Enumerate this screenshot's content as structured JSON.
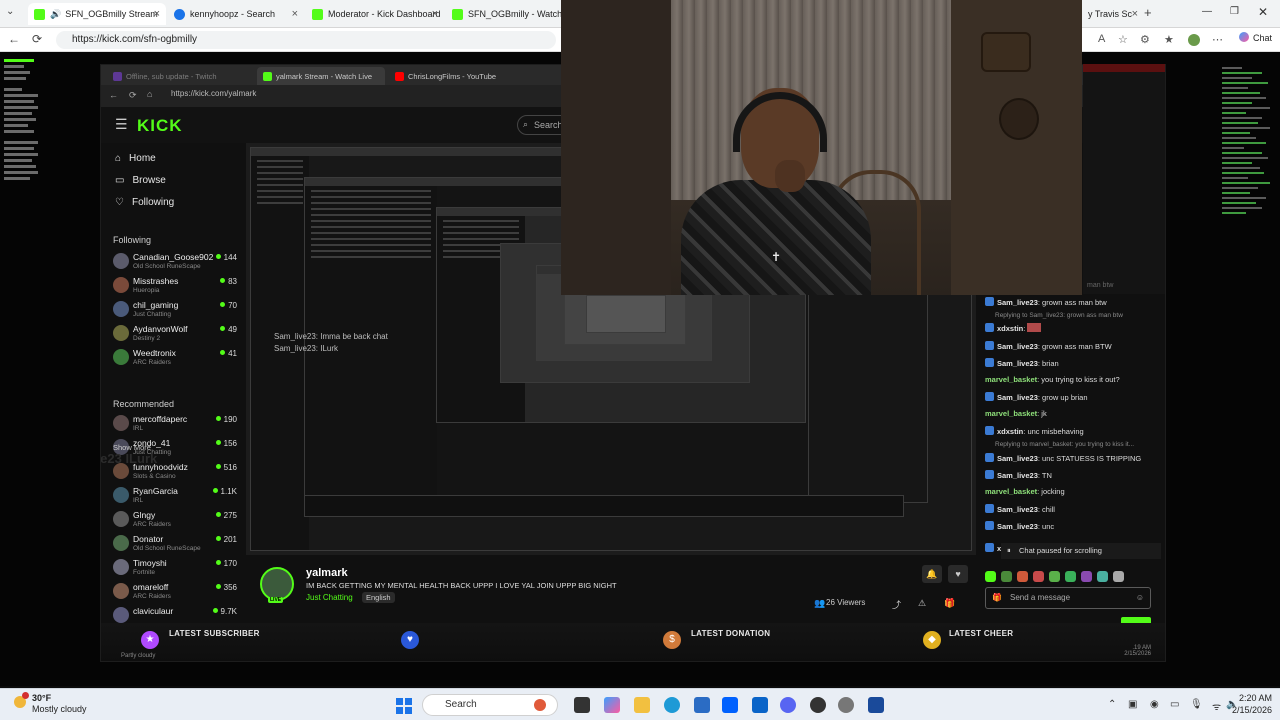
{
  "outer_tabs": [
    {
      "label": "SFN_OGBmilly Stream",
      "color": "#53fc18"
    },
    {
      "label": "kennyhoopz - Search",
      "color": "#1a73e8"
    },
    {
      "label": "Moderator - Kick Dashboard",
      "color": "#53fc18"
    },
    {
      "label": "SFN_OGBmilly - Watch clips",
      "color": "#53fc18"
    },
    {
      "label": "y Travis Sc",
      "color": "#d32f2f"
    }
  ],
  "outer_url": "https://kick.com/sfn-ogbmilly",
  "chat_button": "Chat",
  "inner_tabs": [
    {
      "label": "Offline, sub update - Twitch",
      "color": "#9146ff"
    },
    {
      "label": "yalmark Stream - Watch Live",
      "color": "#53fc18"
    },
    {
      "label": "ChrisLongFilms - YouTube",
      "color": "#ff0000"
    }
  ],
  "inner_url": "https://kick.com/yalmark",
  "kick": {
    "logo": "KICK",
    "search_placeholder": "Search",
    "nav": [
      "Home",
      "Browse",
      "Following"
    ],
    "following_title": "Following",
    "recommended_title": "Recommended",
    "show_more": "Show More",
    "following": [
      {
        "name": "Canadian_Goose902",
        "game": "Old School RuneScape",
        "viewers": "144"
      },
      {
        "name": "Misstrashes",
        "game": "Hueropia",
        "viewers": "83"
      },
      {
        "name": "chil_gaming",
        "game": "Just Chatting",
        "viewers": "70"
      },
      {
        "name": "AydanvonWolf",
        "game": "Destiny 2",
        "viewers": "49"
      },
      {
        "name": "Weedtronix",
        "game": "ARC Raiders",
        "viewers": "41"
      }
    ],
    "recommended": [
      {
        "name": "mercoffdaperc",
        "game": "IRL",
        "viewers": "190"
      },
      {
        "name": "zondo_41",
        "game": "Just Chatting",
        "viewers": "156"
      },
      {
        "name": "funnyhoodvidz",
        "game": "Slots & Casino",
        "viewers": "516"
      },
      {
        "name": "RyanGarcia",
        "game": "IRL",
        "viewers": "1.1K"
      },
      {
        "name": "Glngy",
        "game": "ARC Raiders",
        "viewers": "275"
      },
      {
        "name": "Donator",
        "game": "Old School RuneScape",
        "viewers": "201"
      },
      {
        "name": "Timoyshi",
        "game": "Fortnite",
        "viewers": "170"
      },
      {
        "name": "omareloff",
        "game": "ARC Raiders",
        "viewers": "356"
      },
      {
        "name": "claviculaur",
        "game": "",
        "viewers": "9.7K"
      }
    ]
  },
  "ghost_text": "Sam_live23 ILurk",
  "overlay_lines": [
    "Sam_live23: Imma be back chat",
    "Sam_live23: ILurk"
  ],
  "stream": {
    "name": "yalmark",
    "title": "IM BACK GETTING MY MENTAL HEALTH BACK UPPP I LOVE YAL JOIN UPPP BIG NIGHT",
    "category": "Just Chatting",
    "language": "English",
    "viewers": "26 Viewers",
    "live_badge": "LIVE"
  },
  "chat": {
    "messages": [
      {
        "user": "Sam_live23",
        "text": "grown ass man btw",
        "badge": true
      },
      {
        "reply": "Replying to Sam_live23: grown ass man btw"
      },
      {
        "user": "xdxstin",
        "text": "",
        "badge": true
      },
      {
        "user": "Sam_live23",
        "text": "grown ass man BTW",
        "badge": true
      },
      {
        "user": "Sam_live23",
        "text": "brian",
        "badge": true
      },
      {
        "user": "marvel_basket",
        "text": "you trying to kiss it out?"
      },
      {
        "user": "Sam_live23",
        "text": "grow up brian",
        "badge": true
      },
      {
        "user": "marvel_basket",
        "text": "jk"
      },
      {
        "user": "xdxstin",
        "text": "unc misbehaving",
        "badge": true
      },
      {
        "reply": "Replying to marvel_basket: you trying to kiss it..."
      },
      {
        "user": "Sam_live23",
        "text": "unc STATUESS IS TRIPPING",
        "badge": true
      },
      {
        "user": "Sam_live23",
        "text": "TN",
        "badge": true
      },
      {
        "user": "marvel_basket",
        "text": "jocking"
      },
      {
        "user": "Sam_live23",
        "text": "chill",
        "badge": true
      },
      {
        "user": "Sam_live23",
        "text": "unc",
        "badge": true
      },
      {
        "user": "xdx",
        "text": "",
        "badge": true
      }
    ],
    "paused_text": "Chat paused for scrolling",
    "send_placeholder": "Send a message",
    "ghost_top": "man btw"
  },
  "alerts": {
    "subscriber": "LATEST SUBSCRIBER",
    "donation": "LATEST DONATION",
    "cheer": "LATEST CHEER",
    "weather_small": "Partly cloudy",
    "clock_small": ".19 AM",
    "date_small": "2/15/2026"
  },
  "taskbar": {
    "temp": "30°F",
    "condition": "Mostly cloudy",
    "search": "Search",
    "time": "2:20 AM",
    "date": "2/15/2026"
  }
}
